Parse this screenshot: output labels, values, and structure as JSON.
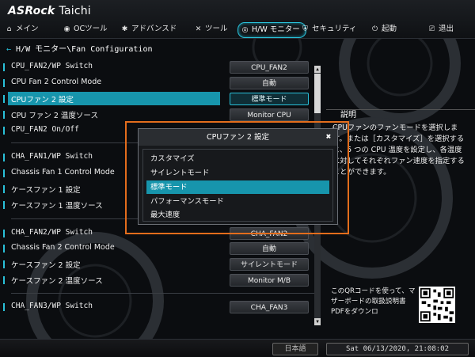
{
  "brand": {
    "logo": "ASRock",
    "model": "Taichi"
  },
  "menu": [
    {
      "icon": "home-icon",
      "glyph": "⌂",
      "label": "メイン"
    },
    {
      "icon": "oc-icon",
      "glyph": "◉",
      "label": "OCツール"
    },
    {
      "icon": "star-icon",
      "glyph": "✱",
      "label": "アドバンスド"
    },
    {
      "icon": "tools-icon",
      "glyph": "✕",
      "label": "ツール"
    },
    {
      "icon": "monitor-icon",
      "glyph": "◎",
      "label": "H/W モニター"
    },
    {
      "icon": "shield-icon",
      "glyph": "⛨",
      "label": "セキュリティ"
    },
    {
      "icon": "power-icon",
      "glyph": "⏻",
      "label": "起動"
    },
    {
      "icon": "exit-icon",
      "glyph": "⎚",
      "label": "退出"
    }
  ],
  "breadcrumb": "H/W モニター\\Fan Configuration",
  "settings": [
    {
      "label": "CPU_FAN2/WP Switch",
      "value": "CPU_FAN2"
    },
    {
      "label": "CPU Fan 2 Control Mode",
      "value": "自動"
    },
    {
      "label": "CPUファン 2 設定",
      "value": "標準モード"
    },
    {
      "label": "CPU ファン 2 温度ソース",
      "value": "Monitor CPU"
    },
    {
      "label": "CPU_FAN2 On/Off",
      "value": ""
    },
    {
      "label": "CHA_FAN1/WP Switch",
      "value": ""
    },
    {
      "label": "Chassis Fan 1 Control Mode",
      "value": ""
    },
    {
      "label": "ケースファン 1 設定",
      "value": ""
    },
    {
      "label": "ケースファン 1 温度ソース",
      "value": ""
    },
    {
      "label": "CHA_FAN2/WP Switch",
      "value": "CHA_FAN2"
    },
    {
      "label": "Chassis Fan 2 Control Mode",
      "value": "自動"
    },
    {
      "label": "ケースファン 2 設定",
      "value": "サイレントモード"
    },
    {
      "label": "ケースファン 2 温度ソース",
      "value": "Monitor M/B"
    },
    {
      "label": "CHA_FAN3/WP Switch",
      "value": "CHA_FAN3"
    }
  ],
  "description": {
    "title": "説明",
    "text": "CPUファンのファンモードを選択します。または［カスタマイズ］を選択すると、5 つの CPU 温度を設定し、各温度に対してそれぞれファン速度を指定することができます。"
  },
  "qr_text": "このQRコードを使って、マザーボードの取扱説明書PDFをダウンロ",
  "popup": {
    "title": "CPUファン 2 設定",
    "options": [
      "カスタマイズ",
      "サイレントモード",
      "標準モード",
      "パフォーマンスモード",
      "最大速度"
    ],
    "selected_index": 2
  },
  "footer": {
    "language": "日本語",
    "datetime": "Sat 06/13/2020, 21:08:02"
  },
  "colors": {
    "accent": "#29c1d9",
    "selection": "#1795ac",
    "highlight_frame": "#e36d1c"
  }
}
